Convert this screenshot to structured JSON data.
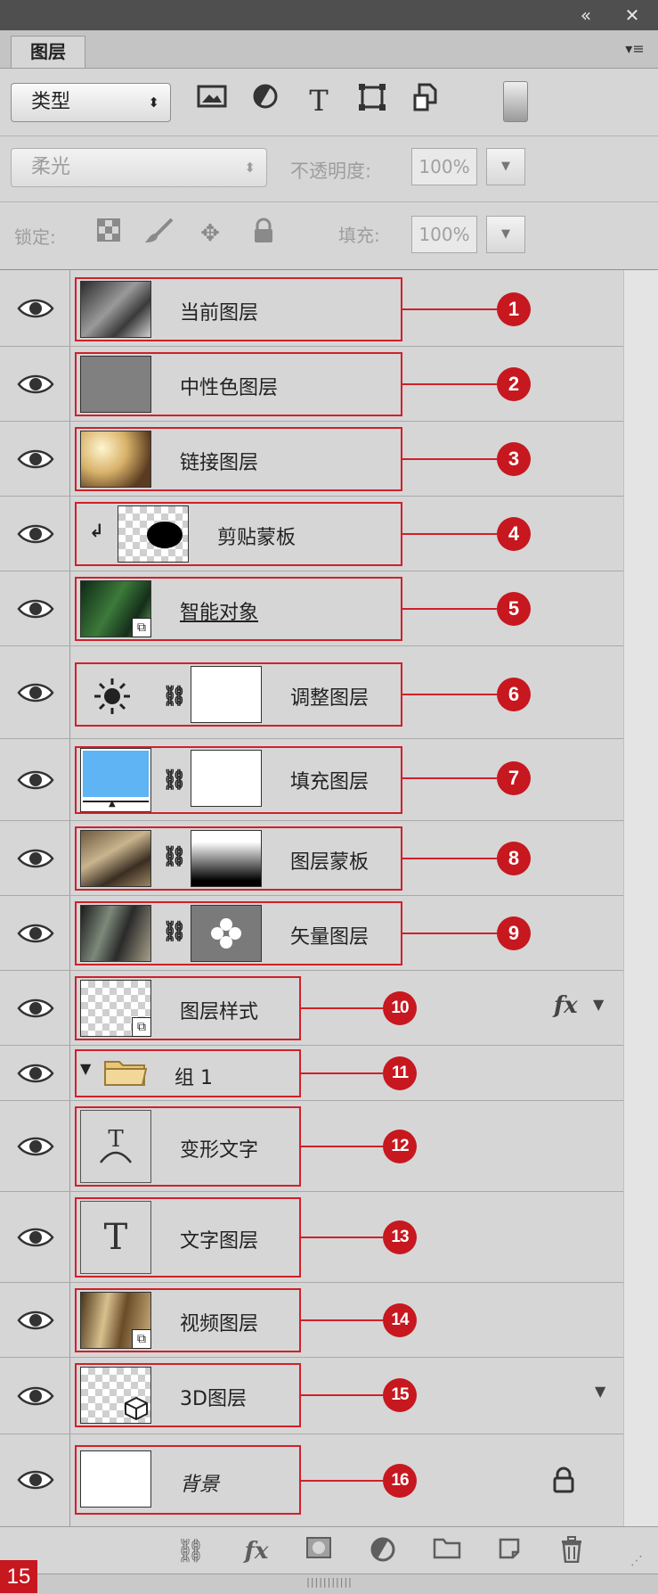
{
  "panel": {
    "tab_label": "图层"
  },
  "filter": {
    "kind_value": "类型",
    "icons": [
      "image-filter-icon",
      "adjustment-filter-icon",
      "type-filter-icon",
      "shape-filter-icon",
      "smart-object-filter-icon"
    ]
  },
  "blend": {
    "mode_value": "柔光",
    "opacity_label": "不透明度:",
    "opacity_value": "100%"
  },
  "lock": {
    "label": "锁定:",
    "fill_label": "填充:",
    "fill_value": "100%"
  },
  "layers": [
    {
      "name": "当前图层",
      "badge": "1"
    },
    {
      "name": "中性色图层",
      "badge": "2"
    },
    {
      "name": "链接图层",
      "badge": "3"
    },
    {
      "name": "剪贴蒙板",
      "badge": "4"
    },
    {
      "name": "智能对象",
      "badge": "5"
    },
    {
      "name": "调整图层",
      "badge": "6"
    },
    {
      "name": "填充图层",
      "badge": "7"
    },
    {
      "name": "图层蒙板",
      "badge": "8"
    },
    {
      "name": "矢量图层",
      "badge": "9"
    },
    {
      "name": "图层样式",
      "badge": "10",
      "fx": "fx"
    },
    {
      "name": "组 1",
      "badge": "11"
    },
    {
      "name": "变形文字",
      "badge": "12"
    },
    {
      "name": "文字图层",
      "badge": "13"
    },
    {
      "name": "视频图层",
      "badge": "14"
    },
    {
      "name": "3D图层",
      "badge": "15"
    },
    {
      "name": "背景",
      "badge": "16"
    }
  ],
  "type_thumb_glyph": "T",
  "footer": {
    "zoom_badge": "15"
  },
  "colors": {
    "panel_bg": "#d6d6d6",
    "callout_red": "#c7171f",
    "fill_layer_blue": "#5fb4f4"
  }
}
